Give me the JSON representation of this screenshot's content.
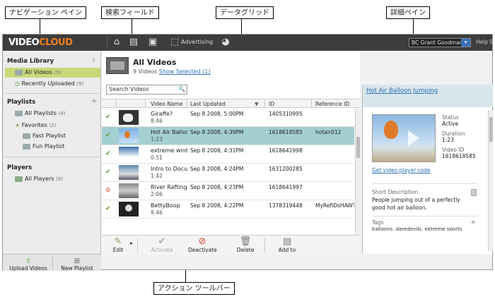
{
  "callouts": {
    "navigation_pane": "ナビゲーション ペイン",
    "search_field": "検索フィールド",
    "data_grid": "データグリッド",
    "detail_pane": "詳細ペイン",
    "action_toolbar": "アクション ツールバー"
  },
  "topbar": {
    "logo_video": "VIDEO",
    "logo_cloud": "CLOUD",
    "advertising": "Advertising",
    "account": "BC Grant Goodman",
    "help": "Help",
    "help2": "S"
  },
  "sidebar": {
    "media_library": "Media Library",
    "all_videos": "All Videos",
    "all_videos_count": "(9)",
    "recently_uploaded": "Recently Uploaded",
    "recently_uploaded_count": "(9)",
    "playlists": "Playlists",
    "all_playlists": "All Playlists",
    "all_playlists_count": "(4)",
    "favorites": "Favorites",
    "favorites_count": "(2)",
    "fast_playlist": "Fast Playlist",
    "fun_playlist": "Fun Playlist",
    "players": "Players",
    "all_players": "All Players",
    "all_players_count": "(9)",
    "upload_videos": "Upload Videos",
    "new_playlist": "New Playlist"
  },
  "main": {
    "title": "All Videos",
    "subtitle_count": "9 Videos",
    "show_selected": "Show Selected (1)",
    "search_placeholder": "Search Videos",
    "columns": [
      "Video Name",
      "Last Updated",
      "ID",
      "Reference ID"
    ],
    "rows": [
      {
        "status": "check",
        "name": "Giraffe?",
        "duration": "8:46",
        "date": "Sep 8 2008, 5:00PM",
        "id": "1405310995",
        "ref": ""
      },
      {
        "status": "check",
        "name": "Hot Air Balloo",
        "duration": "1:23",
        "date": "Sep 8 2008, 4:39PM",
        "id": "1618618585",
        "ref": "hotair012"
      },
      {
        "status": "check",
        "name": "extreme winte",
        "duration": "0:51",
        "date": "Sep 8 2008, 4:31PM",
        "id": "1618641998",
        "ref": ""
      },
      {
        "status": "check",
        "name": "Intro to Docun",
        "duration": "1:42",
        "date": "Sep 8 2008, 4:24PM",
        "id": "1631200285",
        "ref": ""
      },
      {
        "status": "ban",
        "name": "River Rafting",
        "duration": "2:06",
        "date": "Sep 8 2008, 4:23PM",
        "id": "1618641997",
        "ref": ""
      },
      {
        "status": "check",
        "name": "BettyBoop",
        "duration": "8:46",
        "date": "Sep 8 2008, 4:22PM",
        "id": "1378319448",
        "ref": "MyRefIDsHAWT"
      }
    ]
  },
  "actions": {
    "edit": "Edit",
    "activate": "Activate",
    "deactivate": "Deactivate",
    "delete": "Delete",
    "add_to": "Add to"
  },
  "details": {
    "title": "Hot Air Balloon Jumping",
    "status_label": "Status",
    "status_value": "Active",
    "duration_label": "Duration",
    "duration_value": "1:23",
    "videoid_label": "Video ID",
    "videoid_value": "1618618585",
    "get_code": "Get video player code",
    "short_desc_label": "Short Description",
    "short_desc": "People jumping out of a perfectly good hot air balloon.",
    "tags_label": "Tags",
    "tags": "balloons, daredevils, extreme sports"
  },
  "colors": {
    "topbar": "#3d3d3d",
    "logo_accent": "#f07d1c",
    "sidebar_selected": "#c9d97a",
    "grid_selected": "#a3cfd2",
    "link": "#2a6fb0"
  }
}
